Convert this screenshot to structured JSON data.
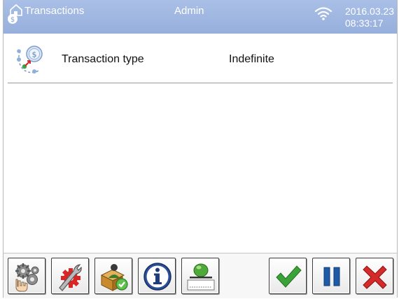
{
  "header": {
    "title": "Transactions",
    "user": "Admin",
    "date": "2016.03.23",
    "time": "08:33:17",
    "icons": [
      "transactions-icon",
      "wifi-icon"
    ]
  },
  "transaction": {
    "label": "Transaction type",
    "value": "Indefinite",
    "icon": "transaction-type-icon"
  },
  "toolbar": {
    "buttons": [
      {
        "name": "settings-button",
        "icon": "gears-hand-icon"
      },
      {
        "name": "tools-button",
        "icon": "wrench-gear-icon"
      },
      {
        "name": "service-button",
        "icon": "box-person-check-icon"
      },
      {
        "name": "info-button",
        "icon": "info-icon"
      },
      {
        "name": "scale-button",
        "icon": "scale-icon"
      },
      {
        "name": "confirm-button",
        "icon": "checkmark-icon"
      },
      {
        "name": "pause-button",
        "icon": "pause-icon"
      },
      {
        "name": "cancel-button",
        "icon": "cross-icon"
      }
    ]
  },
  "colors": {
    "header_bg": "#9db4e0",
    "confirm": "#3aa337",
    "pause": "#1f5aa8",
    "cancel": "#d42a2a"
  }
}
